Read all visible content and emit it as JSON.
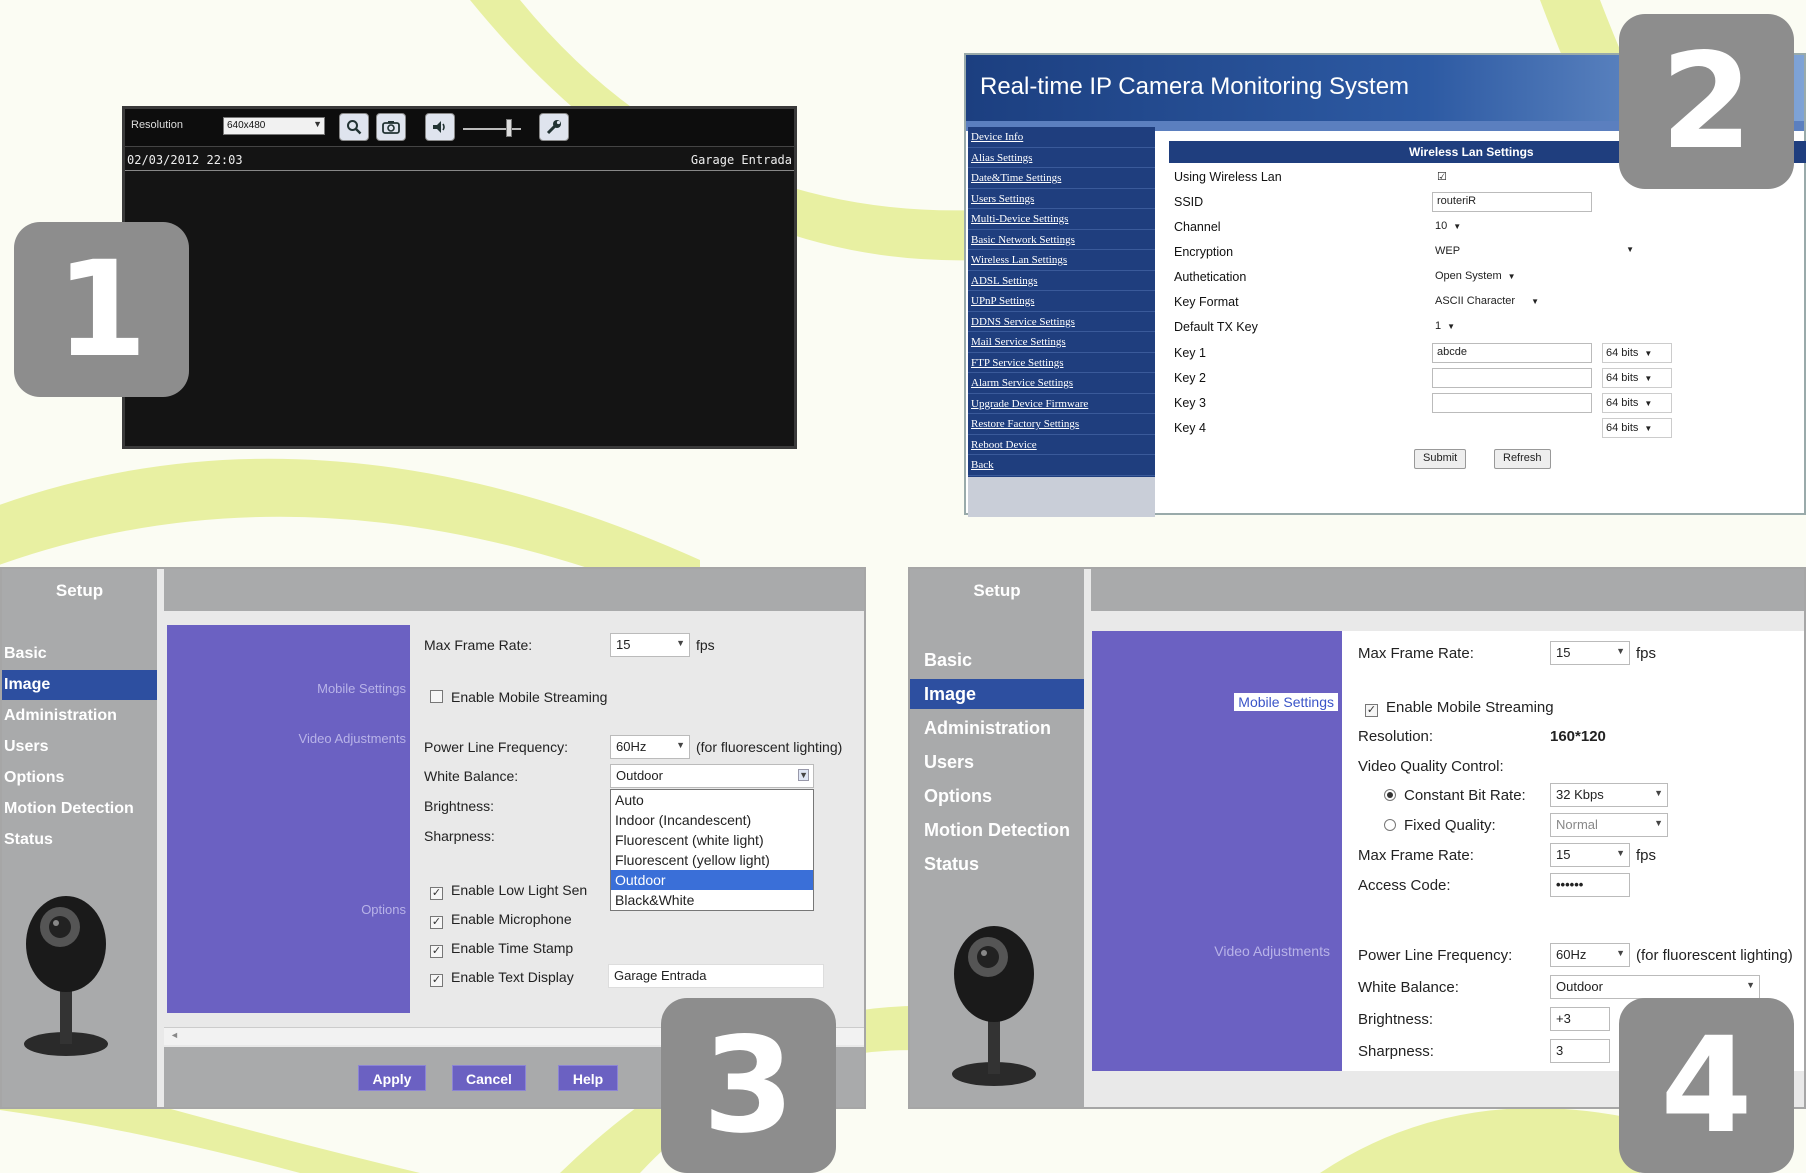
{
  "colors": {
    "background": "#fbfcf3",
    "swoosh": "#e8f0a2",
    "badge": "#8d8d8d",
    "nav_blue": "#1f3e7e",
    "purple": "#6b61c2",
    "selected_blue": "#2d4fa0"
  },
  "badges": [
    "1",
    "2",
    "3",
    "4"
  ],
  "panel1": {
    "resolution_label": "Resolution",
    "resolution_value": "640x480",
    "toolbar_icons": [
      "zoom-icon",
      "snapshot-icon",
      "volume-icon",
      "settings-wrench-icon"
    ],
    "osd_datetime": "02/03/2012 22:03",
    "osd_camera_name": "Garage Entrada"
  },
  "panel2": {
    "title": "Real-time IP Camera Monitoring System",
    "menu": [
      "Device Info",
      "Alias Settings",
      "Date&Time Settings",
      "Users Settings",
      "Multi-Device Settings",
      "Basic Network Settings",
      "Wireless Lan Settings",
      "ADSL Settings",
      "UPnP Settings",
      "DDNS Service Settings",
      "Mail Service Settings",
      "FTP Service Settings",
      "Alarm Service Settings",
      "Upgrade Device Firmware",
      "Restore Factory Settings",
      "Reboot Device",
      "Back"
    ],
    "section_title": "Wireless Lan Settings",
    "fields": [
      {
        "label": "Using Wireless Lan",
        "value": "☑"
      },
      {
        "label": "SSID",
        "value": "routeriR"
      },
      {
        "label": "Channel",
        "value": "10"
      },
      {
        "label": "Encryption",
        "value": "WEP"
      },
      {
        "label": "Authetication",
        "value": "Open System"
      },
      {
        "label": "Key Format",
        "value": "ASCII Character"
      },
      {
        "label": "Default TX Key",
        "value": "1"
      },
      {
        "label": "Key 1",
        "value": "abcde",
        "bits": "64 bits"
      },
      {
        "label": "Key 2",
        "value": "",
        "bits": "64 bits"
      },
      {
        "label": "Key 3",
        "value": "",
        "bits": "64 bits"
      },
      {
        "label": "Key 4",
        "value": "",
        "bits": "64 bits"
      }
    ],
    "submit_label": "Submit",
    "refresh_label": "Refresh"
  },
  "panel3": {
    "sidebar_title": "Setup",
    "nav": [
      "Basic",
      "Image",
      "Administration",
      "Users",
      "Options",
      "Motion Detection",
      "Status"
    ],
    "active_nav": "Image",
    "section_labels": {
      "mobile": "Mobile Settings",
      "video": "Video Adjustments",
      "options": "Options"
    },
    "max_frame_rate_label": "Max Frame Rate:",
    "max_frame_rate_value": "15",
    "fps": "fps",
    "enable_mobile_streaming": "Enable Mobile Streaming",
    "power_line_label": "Power Line Frequency:",
    "power_line_value": "60Hz",
    "power_line_note": "(for fluorescent lighting)",
    "white_balance_label": "White Balance:",
    "white_balance_value": "Outdoor",
    "brightness_label": "Brightness:",
    "sharpness_label": "Sharpness:",
    "white_balance_options": [
      "Auto",
      "Indoor (Incandescent)",
      "Fluorescent (white light)",
      "Fluorescent (yellow light)",
      "Outdoor",
      "Black&White"
    ],
    "highlighted_option": "Outdoor",
    "checkboxes": [
      "Enable Low Light Sen",
      "Enable Microphone",
      "Enable Time Stamp",
      "Enable Text Display"
    ],
    "text_display_value": "Garage Entrada",
    "apply_label": "Apply",
    "cancel_label": "Cancel",
    "help_label": "Help"
  },
  "panel4": {
    "sidebar_title": "Setup",
    "nav": [
      "Basic",
      "Image",
      "Administration",
      "Users",
      "Options",
      "Motion Detection",
      "Status"
    ],
    "active_nav": "Image",
    "mobile_settings_label": "Mobile Settings",
    "video_adjustments_label": "Video Adjustments",
    "max_frame_rate_label": "Max Frame Rate:",
    "max_frame_rate_value": "15",
    "fps": "fps",
    "enable_mobile_streaming": "Enable Mobile Streaming",
    "resolution_label": "Resolution:",
    "resolution_value": "160*120",
    "video_quality_label": "Video Quality Control:",
    "constant_bit_rate_label": "Constant Bit Rate:",
    "constant_bit_rate_value": "32 Kbps",
    "fixed_quality_label": "Fixed Quality:",
    "fixed_quality_value": "Normal",
    "mobile_max_frame_rate_label": "Max Frame Rate:",
    "mobile_max_frame_rate_value": "15",
    "access_code_label": "Access Code:",
    "access_code_value": "••••••",
    "power_line_label": "Power Line Frequency:",
    "power_line_value": "60Hz",
    "power_line_note": "(for fluorescent lighting)",
    "white_balance_label": "White Balance:",
    "white_balance_value": "Outdoor",
    "brightness_label": "Brightness:",
    "brightness_value": "+3",
    "sharpness_label": "Sharpness:",
    "sharpness_value": "3"
  }
}
